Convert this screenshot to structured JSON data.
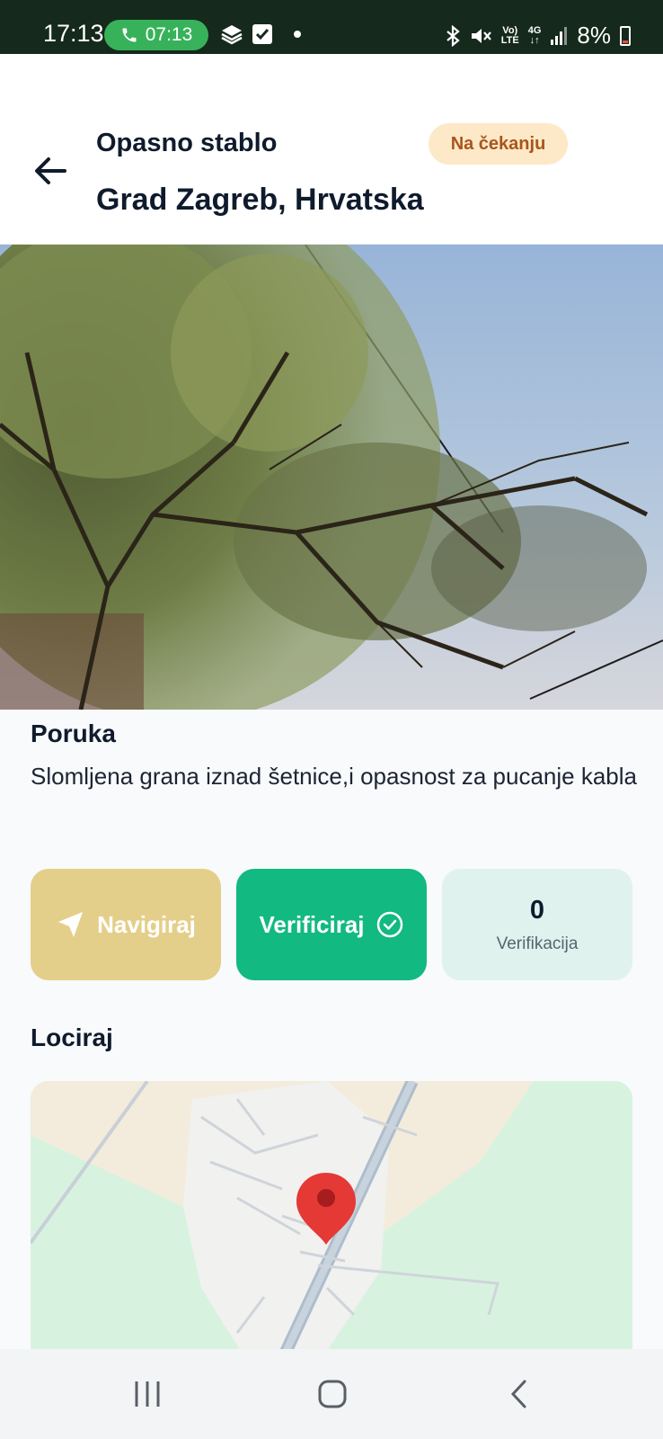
{
  "status_bar": {
    "time": "17:13",
    "call_time": "07:13",
    "network_label_top": "Vo)",
    "network_label_bottom": "LTE",
    "network_gen": "4G",
    "battery": "8%"
  },
  "header": {
    "title": "Opasno stablo",
    "location": "Grad Zagreb, Hrvatska",
    "status_badge": "Na čekanju"
  },
  "message_section": {
    "title": "Poruka",
    "text": "Slomljena grana iznad šetnice,i opasnost za pucanje kabla"
  },
  "actions": {
    "navigate_label": "Navigiraj",
    "verify_label": "Verificiraj",
    "verification_count": "0",
    "verification_label": "Verifikacija"
  },
  "map_section": {
    "title": "Lociraj"
  },
  "icons": {
    "back": "arrow-left-icon",
    "navigate": "navigation-arrow-icon",
    "verify": "check-circle-icon",
    "map_pin": "map-pin-icon"
  },
  "colors": {
    "status_bar_bg": "#15291d",
    "call_pill": "#38b25a",
    "badge_bg": "#fde8c8",
    "badge_text": "#a8561b",
    "navigate_btn": "#e4cf8a",
    "verify_btn": "#12b981",
    "stat_bg": "#dff2ee",
    "map_pin": "#e53935"
  }
}
